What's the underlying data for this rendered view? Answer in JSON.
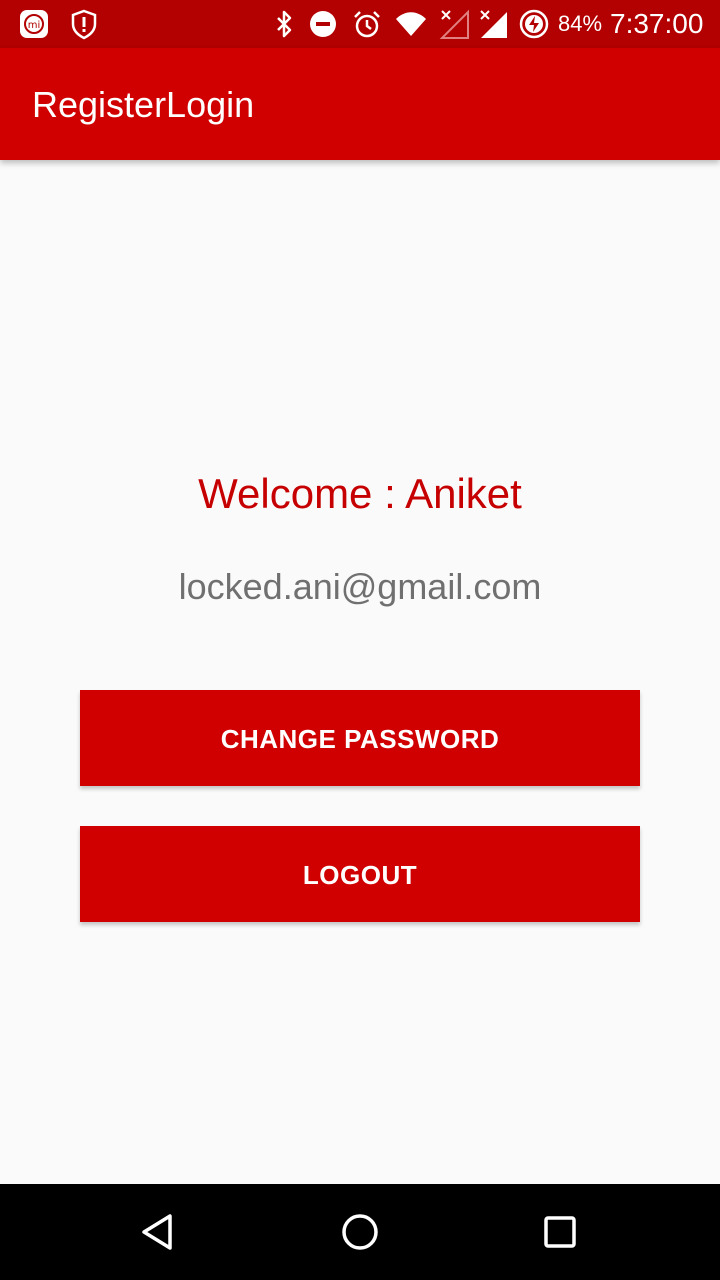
{
  "status_bar": {
    "battery_percent": "84%",
    "time": "7:37:00",
    "icons": [
      "mi-icon",
      "shield-alert-icon",
      "bluetooth-icon",
      "do-not-disturb-icon",
      "alarm-icon",
      "wifi-icon",
      "signal-no-sim-icon",
      "signal-icon",
      "battery-charging-icon"
    ]
  },
  "app_bar": {
    "title": "RegisterLogin"
  },
  "main": {
    "welcome_text": "Welcome : Aniket",
    "email_text": "locked.ani@gmail.com",
    "change_password_label": "CHANGE PASSWORD",
    "logout_label": "LOGOUT"
  },
  "nav_bar": {
    "icons": [
      "back-icon",
      "home-icon",
      "recents-icon"
    ]
  },
  "colors": {
    "status_bar": "#b30000",
    "primary": "#d10000",
    "welcome_text": "#c60000",
    "email_text": "#707070",
    "background": "#fafafa"
  }
}
